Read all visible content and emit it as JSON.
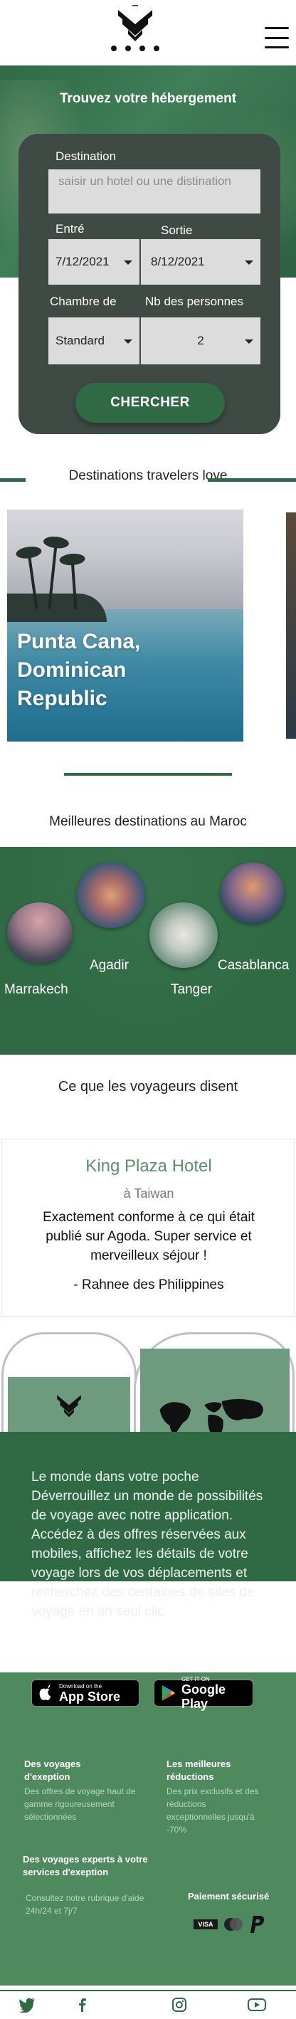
{
  "header": {
    "logo_name": "agoda-style-logo",
    "menu_icon": "hamburger-menu-icon"
  },
  "hero": {
    "title": "Trouvez votre hébergement",
    "destination_label": "Destination",
    "destination_placeholder": "saisir un hotel ou une distination",
    "checkin_label": "Entré",
    "checkin_value": "7/12/2021",
    "checkout_label": "Sortie",
    "checkout_value": "8/12/2021",
    "room_label": "Chambre de",
    "room_value": "Standard",
    "persons_label": "Nb des personnes",
    "persons_value": "2",
    "search_button": "CHERCHER"
  },
  "travelers_love": {
    "heading": "Destinations travelers love",
    "cards": [
      {
        "caption": "Punta Cana, Dominican Republic"
      }
    ]
  },
  "morocco": {
    "heading": "Meilleures destinations au Maroc",
    "cities": [
      {
        "name": "Marrakech"
      },
      {
        "name": "Agadir"
      },
      {
        "name": "Tanger"
      },
      {
        "name": "Casablanca"
      }
    ]
  },
  "testimonials": {
    "heading": "Ce que les voyageurs disent",
    "hotel": "King Plaza Hotel",
    "location": "à Taiwan",
    "quote": "Exactement conforme à ce qui était publié sur Agoda. Super service et merveilleux séjour !",
    "author": "- Rahnee des Philippines"
  },
  "app": {
    "text": "Le monde dans votre poche Déverrouillez un monde de possibilités de voyage avec notre application. Accédez à des offres réservées aux mobiles, affichez les détails de votre voyage lors de vos déplacements et recherchez des centaines de sites de voyage en un seul clic.",
    "appstore_small": "Download on the",
    "appstore_big": "App Store",
    "googleplay_small": "GET IT ON",
    "googleplay_big": "Google Play"
  },
  "footer": {
    "col1_title": "Des voyages d'exeption",
    "col1_text": "Des offres de voyage haut de gamme rigoureusement sélectionnées",
    "col2_title": "Les meilleures réductions",
    "col2_text": "Des prix exclusifs et des réductions exceptionnelles jusqu'à -70%",
    "col3_title": "Des voyages experts à votre services d'exeption",
    "col3_text": "Consultez notre rubrique d'aide 24h/24 et 7j/7",
    "col4_title": "Paiement sécurisé",
    "payment_icons": [
      "visa-icon",
      "mastercard-icon",
      "paypal-icon"
    ]
  },
  "social": [
    "twitter-icon",
    "facebook-icon",
    "instagram-icon",
    "youtube-icon"
  ],
  "colors": {
    "brand_green": "#2f6a44",
    "footer_green": "#4e8a5e",
    "search_box": "#3f4a44"
  }
}
